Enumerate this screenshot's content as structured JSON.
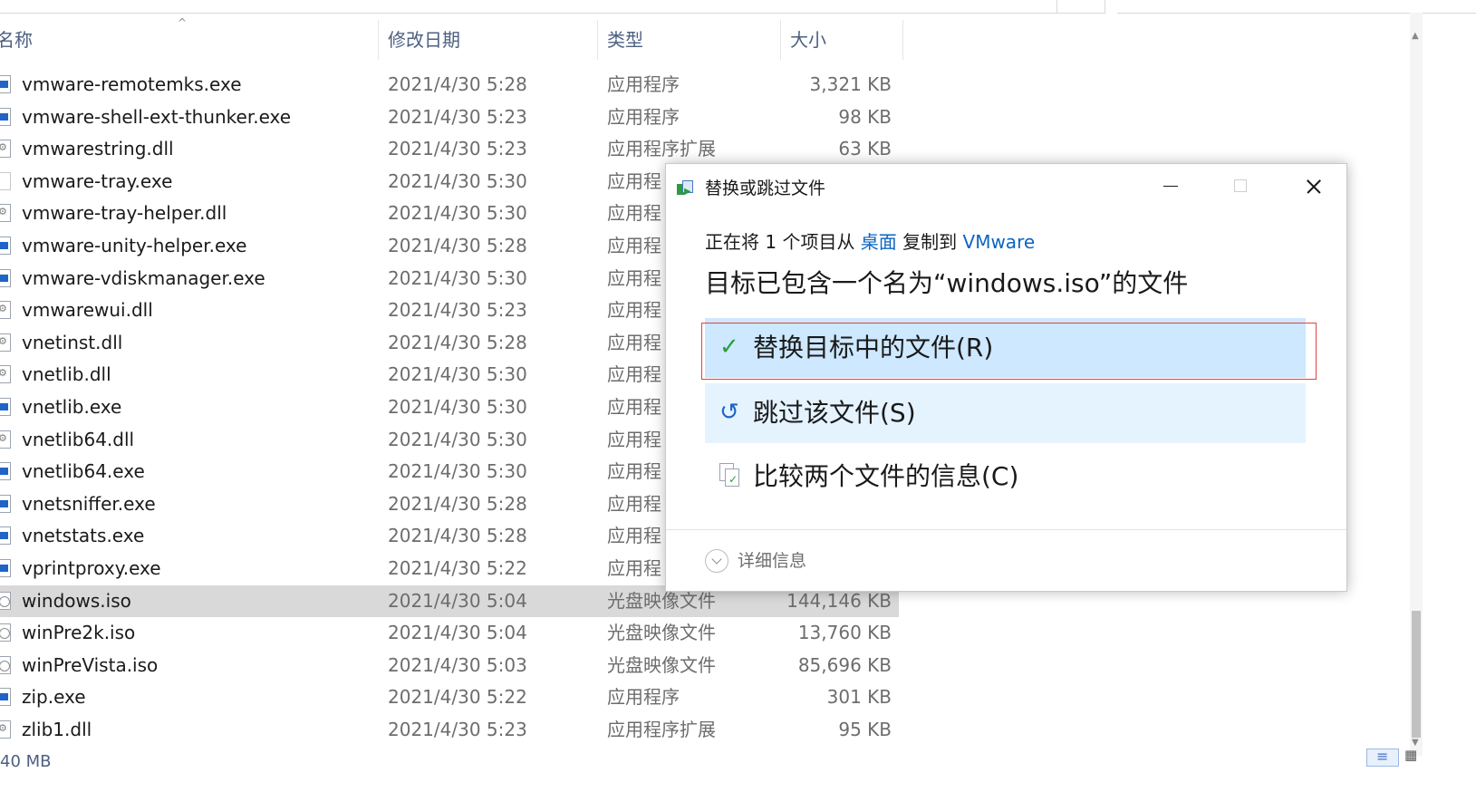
{
  "explorer": {
    "columns": {
      "name": "名称",
      "date": "修改日期",
      "type": "类型",
      "size": "大小"
    },
    "files": [
      {
        "name": "vmware-remotemks.exe",
        "date": "2021/4/30 5:28",
        "type": "应用程序",
        "size": "3,321 KB",
        "icon": "exe-icon"
      },
      {
        "name": "vmware-shell-ext-thunker.exe",
        "date": "2021/4/30 5:23",
        "type": "应用程序",
        "size": "98 KB",
        "icon": "exe-icon"
      },
      {
        "name": "vmwarestring.dll",
        "date": "2021/4/30 5:23",
        "type": "应用程序扩展",
        "size": "63 KB",
        "icon": "dll-icon"
      },
      {
        "name": "vmware-tray.exe",
        "date": "2021/4/30 5:30",
        "type": "应用程",
        "size": "",
        "icon": "blank-file-icon"
      },
      {
        "name": "vmware-tray-helper.dll",
        "date": "2021/4/30 5:30",
        "type": "应用程",
        "size": "",
        "icon": "dll-icon"
      },
      {
        "name": "vmware-unity-helper.exe",
        "date": "2021/4/30 5:28",
        "type": "应用程",
        "size": "",
        "icon": "exe-icon"
      },
      {
        "name": "vmware-vdiskmanager.exe",
        "date": "2021/4/30 5:30",
        "type": "应用程",
        "size": "",
        "icon": "exe-icon"
      },
      {
        "name": "vmwarewui.dll",
        "date": "2021/4/30 5:23",
        "type": "应用程",
        "size": "",
        "icon": "dll-icon"
      },
      {
        "name": "vnetinst.dll",
        "date": "2021/4/30 5:28",
        "type": "应用程",
        "size": "",
        "icon": "dll-icon"
      },
      {
        "name": "vnetlib.dll",
        "date": "2021/4/30 5:30",
        "type": "应用程",
        "size": "",
        "icon": "dll-icon"
      },
      {
        "name": "vnetlib.exe",
        "date": "2021/4/30 5:30",
        "type": "应用程",
        "size": "",
        "icon": "exe-icon"
      },
      {
        "name": "vnetlib64.dll",
        "date": "2021/4/30 5:30",
        "type": "应用程",
        "size": "",
        "icon": "dll-icon"
      },
      {
        "name": "vnetlib64.exe",
        "date": "2021/4/30 5:30",
        "type": "应用程",
        "size": "",
        "icon": "exe-icon"
      },
      {
        "name": "vnetsniffer.exe",
        "date": "2021/4/30 5:28",
        "type": "应用程",
        "size": "",
        "icon": "exe-icon"
      },
      {
        "name": "vnetstats.exe",
        "date": "2021/4/30 5:28",
        "type": "应用程",
        "size": "",
        "icon": "exe-icon"
      },
      {
        "name": "vprintproxy.exe",
        "date": "2021/4/30 5:22",
        "type": "应用程",
        "size": "",
        "icon": "exe-icon"
      },
      {
        "name": "windows.iso",
        "date": "2021/4/30 5:04",
        "type": "光盘映像文件",
        "size": "144,146 KB",
        "icon": "iso-icon",
        "selected": true
      },
      {
        "name": "winPre2k.iso",
        "date": "2021/4/30 5:04",
        "type": "光盘映像文件",
        "size": "13,760 KB",
        "icon": "iso-icon"
      },
      {
        "name": "winPreVista.iso",
        "date": "2021/4/30 5:03",
        "type": "光盘映像文件",
        "size": "85,696 KB",
        "icon": "iso-icon"
      },
      {
        "name": "zip.exe",
        "date": "2021/4/30 5:22",
        "type": "应用程序",
        "size": "301 KB",
        "icon": "exe-icon"
      },
      {
        "name": "zlib1.dll",
        "date": "2021/4/30 5:23",
        "type": "应用程序扩展",
        "size": "95 KB",
        "icon": "dll-icon"
      }
    ],
    "status_text": "40 MB"
  },
  "dialog": {
    "title": "替换或跳过文件",
    "copy_prefix": "正在将 1 个项目从 ",
    "copy_source": "桌面",
    "copy_middle": " 复制到 ",
    "copy_dest": "VMware",
    "heading": "目标已包含一个名为“windows.iso”的文件",
    "options": {
      "replace": "替换目标中的文件(R)",
      "skip": "跳过该文件(S)",
      "compare": "比较两个文件的信息(C)"
    },
    "details_label": "详细信息"
  },
  "colors": {
    "accent_link": "#0a66c2",
    "replace_bg": "#cde8ff",
    "skip_bg": "#e5f3ff",
    "highlight_border": "#e84040",
    "selected_row": "#d9d9d9"
  }
}
